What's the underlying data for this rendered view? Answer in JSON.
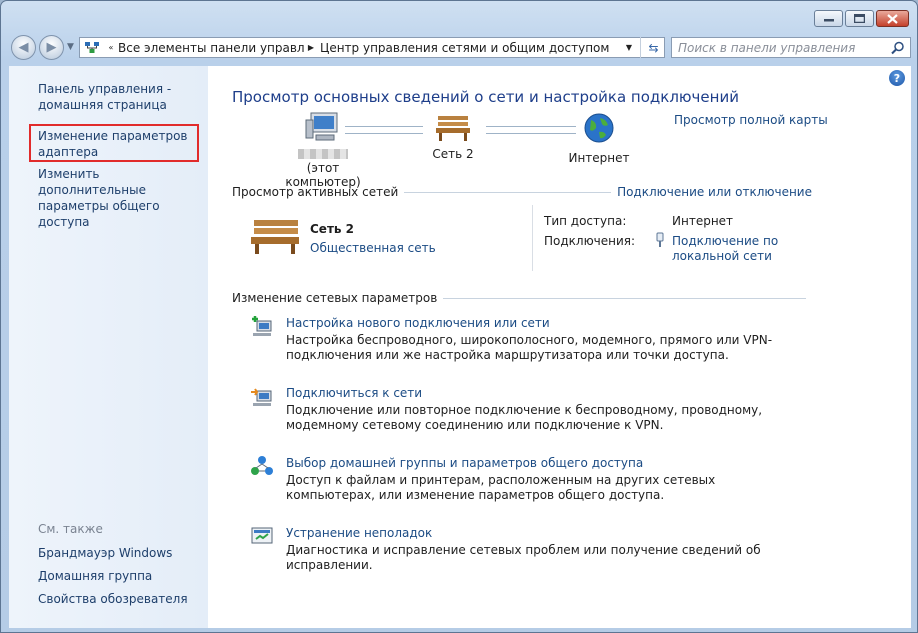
{
  "window": {
    "controls": {
      "minimize": "minimize-icon",
      "maximize": "maximize-icon",
      "close": "close-icon"
    }
  },
  "nav": {
    "breadcrumb": [
      "Все элементы панели управлен...",
      "Центр управления сетями и общим доступом"
    ],
    "search_placeholder": "Поиск в панели управления"
  },
  "sidebar": {
    "items": [
      "Панель управления - домашняя страница",
      "Изменение параметров адаптера",
      "Изменить дополнительные параметры общего доступа"
    ],
    "see_also_label": "См. также",
    "see_also": [
      "Брандмауэр Windows",
      "Домашняя группа",
      "Свойства обозревателя"
    ]
  },
  "main": {
    "title": "Просмотр основных сведений о сети и настройка подключений",
    "full_map_link": "Просмотр полной карты",
    "map": {
      "computer_label": "(этот компьютер)",
      "network_label": "Сеть 2",
      "internet_label": "Интернет"
    },
    "active": {
      "header": "Просмотр активных сетей",
      "connect_link": "Подключение или отключение",
      "network_name": "Сеть 2",
      "network_type": "Общественная сеть",
      "access_type_label": "Тип доступа:",
      "access_type_value": "Интернет",
      "connections_label": "Подключения:",
      "connection_value": "Подключение по локальной сети"
    },
    "change_header": "Изменение сетевых параметров",
    "tasks": [
      {
        "title": "Настройка нового подключения или сети",
        "desc": "Настройка беспроводного, широкополосного, модемного, прямого или VPN-подключения или же настройка маршрутизатора или точки доступа."
      },
      {
        "title": "Подключиться к сети",
        "desc": "Подключение или повторное подключение к беспроводному, проводному, модемному сетевому соединению или подключение к VPN."
      },
      {
        "title": "Выбор домашней группы и параметров общего доступа",
        "desc": "Доступ к файлам и принтерам, расположенным на других сетевых компьютерах, или изменение параметров общего доступа."
      },
      {
        "title": "Устранение неполадок",
        "desc": "Диагностика и исправление сетевых проблем или получение сведений об исправлении."
      }
    ]
  },
  "colors": {
    "title": "#1e3e8a",
    "link": "#1b4b84",
    "highlight": "#e12b2b"
  }
}
